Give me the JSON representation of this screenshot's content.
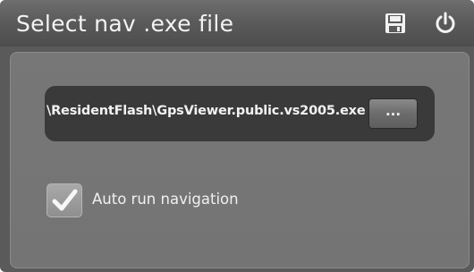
{
  "window": {
    "title": "Select nav .exe file"
  },
  "titlebar": {
    "save_icon": "floppy-disk-icon",
    "power_icon": "power-icon"
  },
  "file_select": {
    "path": "\\ResidentFlash\\GpsViewer.public.vs2005.exe",
    "browse_label": "..."
  },
  "options": {
    "auto_run": {
      "label": "Auto run navigation",
      "checked": true
    }
  },
  "colors": {
    "background": "#5a5a5a",
    "panel": "#777777",
    "path_box": "#3a3a3a",
    "text": "#f0f0f0"
  }
}
